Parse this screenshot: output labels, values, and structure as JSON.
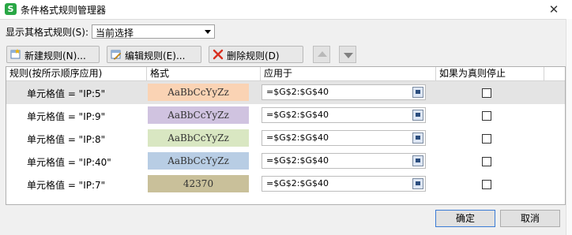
{
  "window": {
    "title": "条件格式规则管理器",
    "app_icon_letter": "S",
    "close_glyph": "✕"
  },
  "show_rules": {
    "label": "显示其格式规则(S):",
    "selected": "当前选择"
  },
  "toolbar": {
    "new_rule": "新建规则(N)...",
    "edit_rule": "编辑规则(E)...",
    "delete_rule": "删除规则(D)",
    "move_up_icon": "triangle-up-icon",
    "move_down_icon": "triangle-down-icon"
  },
  "columns": {
    "rule": "规则(按所示顺序应用)",
    "format": "格式",
    "applies_to": "应用于",
    "stop_if_true": "如果为真则停止"
  },
  "rules": [
    {
      "rule": "单元格值 = \"IP:5\"",
      "preview": "AaBbCcYyZz",
      "color": "#fad3b4",
      "range": "=$G$2:$G$40",
      "stop": false,
      "selected": true
    },
    {
      "rule": "单元格值 = \"IP:9\"",
      "preview": "AaBbCcYyZz",
      "color": "#d0c3e0",
      "range": "=$G$2:$G$40",
      "stop": false,
      "selected": false
    },
    {
      "rule": "单元格值 = \"IP:8\"",
      "preview": "AaBbCcYyZz",
      "color": "#d9e7c2",
      "range": "=$G$2:$G$40",
      "stop": false,
      "selected": false
    },
    {
      "rule": "单元格值 = \"IP:40\"",
      "preview": "AaBbCcYyZz",
      "color": "#b8cde4",
      "range": "=$G$2:$G$40",
      "stop": false,
      "selected": false
    },
    {
      "rule": "单元格值 = \"IP:7\"",
      "preview": "42370",
      "color": "#c9c09a",
      "range": "=$G$2:$G$40",
      "stop": false,
      "selected": false
    }
  ],
  "buttons": {
    "ok": "确定",
    "cancel": "取消"
  }
}
